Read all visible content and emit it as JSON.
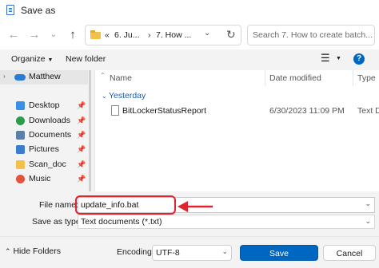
{
  "window": {
    "title": "Save as"
  },
  "address_bar": {
    "crumbs": [
      "«",
      "6. Ju...",
      "›",
      "7. How ..."
    ]
  },
  "search": {
    "placeholder": "Search 7. How to create batch..."
  },
  "toolbar": {
    "organize": "Organize",
    "new_folder": "New folder"
  },
  "nav_pane": {
    "items": [
      {
        "label": "Matthew",
        "icon": "cloud-icon",
        "pinned": false,
        "color": "#2b7bd6"
      },
      {
        "label": "Desktop",
        "icon": "desktop-icon",
        "pinned": true,
        "color": "#3a8ee6"
      },
      {
        "label": "Downloads",
        "icon": "download-icon",
        "pinned": true,
        "color": "#2a9d4a"
      },
      {
        "label": "Documents",
        "icon": "documents-icon",
        "pinned": true,
        "color": "#5a7fa8"
      },
      {
        "label": "Pictures",
        "icon": "pictures-icon",
        "pinned": true,
        "color": "#3b7bd0"
      },
      {
        "label": "Scan_doc",
        "icon": "folder-icon",
        "pinned": true,
        "color": "#f3c14b"
      },
      {
        "label": "Music",
        "icon": "music-icon",
        "pinned": true,
        "color": "#e2543e"
      }
    ]
  },
  "file_list": {
    "columns": [
      "Name",
      "Date modified",
      "Type"
    ],
    "groups": [
      {
        "label": "Yesterday",
        "files": [
          {
            "name": "BitLockerStatusReport",
            "date": "6/30/2023 11:09 PM",
            "type": "Text D"
          }
        ]
      }
    ]
  },
  "form": {
    "file_name_label": "File name:",
    "file_name_value": "update_info.bat",
    "save_as_type_label": "Save as type:",
    "save_as_type_value": "Text documents (*.txt)",
    "encoding_label": "Encoding:",
    "encoding_value": "UTF-8"
  },
  "footer": {
    "hide_folders": "Hide Folders",
    "save": "Save",
    "cancel": "Cancel"
  },
  "colors": {
    "accent": "#0067c0",
    "highlight": "#e0232e"
  }
}
